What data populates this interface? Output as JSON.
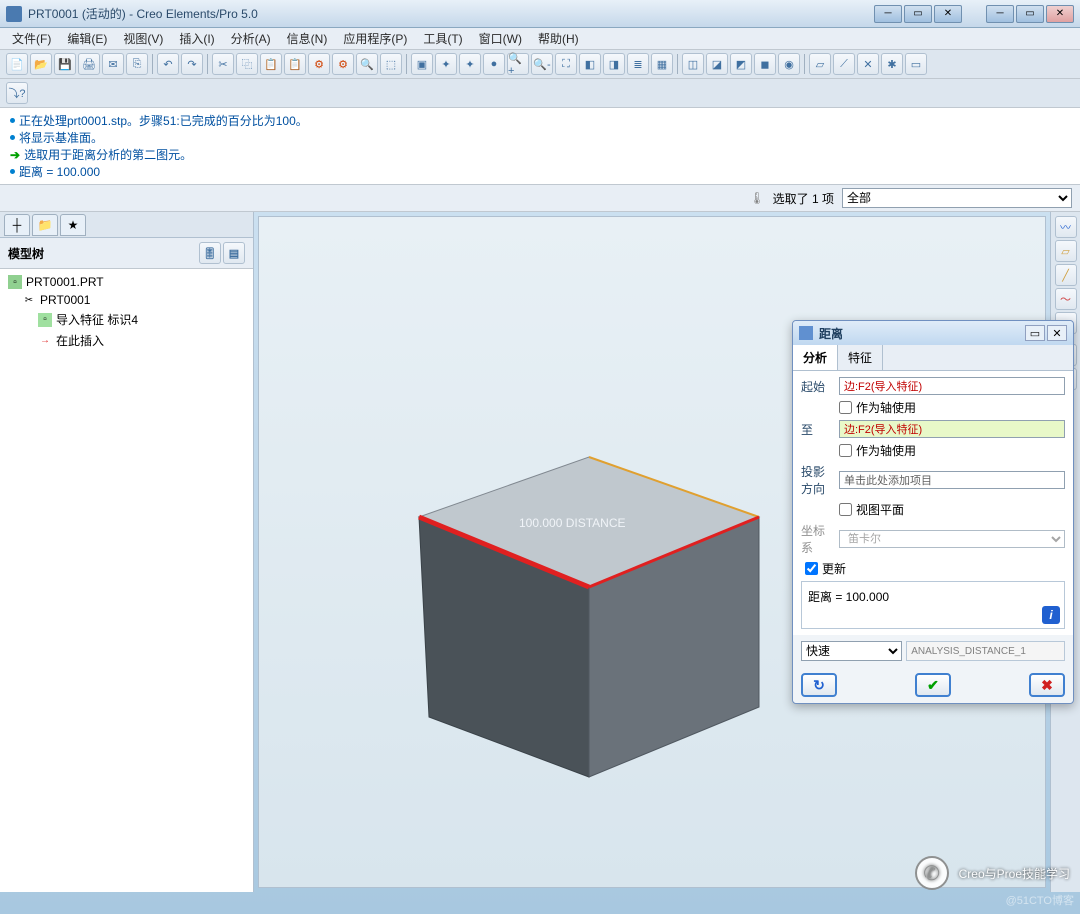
{
  "title": "PRT0001 (活动的) - Creo Elements/Pro 5.0",
  "menu": [
    "文件(F)",
    "编辑(E)",
    "视图(V)",
    "插入(I)",
    "分析(A)",
    "信息(N)",
    "应用程序(P)",
    "工具(T)",
    "窗口(W)",
    "帮助(H)"
  ],
  "messages": [
    "正在处理prt0001.stp。步骤51:已完成的百分比为100。",
    "将显示基准面。",
    "选取用于距离分析的第二图元。",
    "距离 = 100.000"
  ],
  "selection": {
    "label": "选取了 1 项",
    "filter": "全部"
  },
  "tree": {
    "title": "模型树",
    "root": "PRT0001.PRT",
    "nodes": [
      "PRT0001",
      "导入特征 标识4",
      "在此插入"
    ]
  },
  "annotation": "100.000  DISTANCE",
  "panel": {
    "title": "距离",
    "tabs": [
      "分析",
      "特征"
    ],
    "from_label": "起始",
    "from_value": "边:F2(导入特征)",
    "as_axis": "作为轴使用",
    "to_label": "至",
    "to_value": "边:F2(导入特征)",
    "proj_label": "投影\n方向",
    "proj_placeholder": "单击此处添加项目",
    "view_plane": "视图平面",
    "coord_label": "坐标系",
    "coord_value": "笛卡尔",
    "update": "更新",
    "result": "距离 = 100.000",
    "type": "快速",
    "name": "ANALYSIS_DISTANCE_1"
  },
  "watermark": "Creo与Proe技能学习",
  "watermark2": "@51CTO博客"
}
